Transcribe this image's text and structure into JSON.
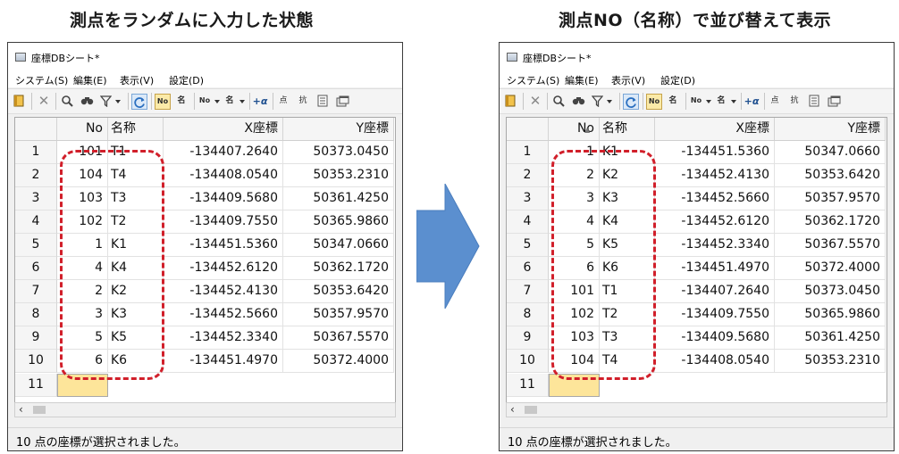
{
  "captions": {
    "left": "測点をランダムに入力した状態",
    "right": "測点NO（名称）で並び替えて表示"
  },
  "colors": {
    "annotation_dash": "#d11f2a",
    "arrow_fill": "#5b8fcf",
    "new_row_cell": "#fde59a"
  },
  "window": {
    "title": "座標DBシート*",
    "menu": [
      "システム(S)",
      "編集(E)",
      "表示(V)",
      "設定(D)"
    ],
    "toolbar_icons": [
      "bookmark-icon",
      "delete-icon",
      "search-icon",
      "binoculars-icon",
      "filter-icon",
      "refresh-icon",
      "no-sort-icon",
      "name-sort-icon",
      "no-ascending-icon",
      "name-ascending-icon",
      "add-alpha-icon",
      "point-icon",
      "point-alt-icon",
      "document-icon",
      "window-icon"
    ]
  },
  "grid": {
    "headers": {
      "no": "No",
      "name": "名称",
      "x": "X座標",
      "y": "Y座標"
    },
    "new_row_label": "11"
  },
  "left_panel": {
    "rows": [
      {
        "row": "1",
        "no": "101",
        "name": "T1",
        "x": "-134407.2640",
        "y": "50373.0450"
      },
      {
        "row": "2",
        "no": "104",
        "name": "T4",
        "x": "-134408.0540",
        "y": "50353.2310"
      },
      {
        "row": "3",
        "no": "103",
        "name": "T3",
        "x": "-134409.5680",
        "y": "50361.4250"
      },
      {
        "row": "4",
        "no": "102",
        "name": "T2",
        "x": "-134409.7550",
        "y": "50365.9860"
      },
      {
        "row": "5",
        "no": "1",
        "name": "K1",
        "x": "-134451.5360",
        "y": "50347.0660"
      },
      {
        "row": "6",
        "no": "4",
        "name": "K4",
        "x": "-134452.6120",
        "y": "50362.1720"
      },
      {
        "row": "7",
        "no": "2",
        "name": "K2",
        "x": "-134452.4130",
        "y": "50353.6420"
      },
      {
        "row": "8",
        "no": "3",
        "name": "K3",
        "x": "-134452.5660",
        "y": "50357.9570"
      },
      {
        "row": "9",
        "no": "5",
        "name": "K5",
        "x": "-134452.3340",
        "y": "50367.5570"
      },
      {
        "row": "10",
        "no": "6",
        "name": "K6",
        "x": "-134451.4970",
        "y": "50372.4000"
      }
    ],
    "status": "10 点の座標が選択されました。"
  },
  "right_panel": {
    "rows": [
      {
        "row": "1",
        "no": "1",
        "name": "K1",
        "x": "-134451.5360",
        "y": "50347.0660"
      },
      {
        "row": "2",
        "no": "2",
        "name": "K2",
        "x": "-134452.4130",
        "y": "50353.6420"
      },
      {
        "row": "3",
        "no": "3",
        "name": "K3",
        "x": "-134452.5660",
        "y": "50357.9570"
      },
      {
        "row": "4",
        "no": "4",
        "name": "K4",
        "x": "-134452.6120",
        "y": "50362.1720"
      },
      {
        "row": "5",
        "no": "5",
        "name": "K5",
        "x": "-134452.3340",
        "y": "50367.5570"
      },
      {
        "row": "6",
        "no": "6",
        "name": "K6",
        "x": "-134451.4970",
        "y": "50372.4000"
      },
      {
        "row": "7",
        "no": "101",
        "name": "T1",
        "x": "-134407.2640",
        "y": "50373.0450"
      },
      {
        "row": "8",
        "no": "102",
        "name": "T2",
        "x": "-134409.7550",
        "y": "50365.9860"
      },
      {
        "row": "9",
        "no": "103",
        "name": "T3",
        "x": "-134409.5680",
        "y": "50361.4250"
      },
      {
        "row": "10",
        "no": "104",
        "name": "T4",
        "x": "-134408.0540",
        "y": "50353.2310"
      }
    ],
    "status": "10 点の座標が選択されました。"
  }
}
